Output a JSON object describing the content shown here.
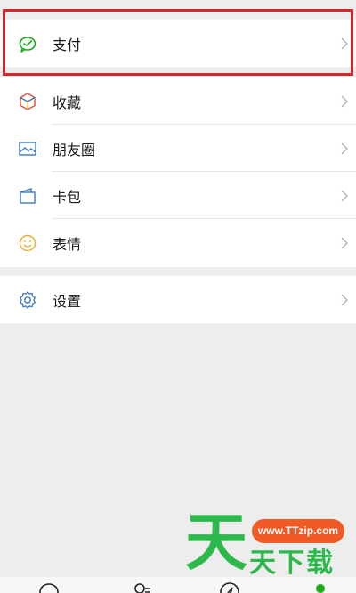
{
  "menu": {
    "pay": {
      "label": "支付",
      "icon": "wechat-pay-icon"
    },
    "items": [
      {
        "label": "收藏",
        "icon": "favorites-cube-icon"
      },
      {
        "label": "朋友圈",
        "icon": "moments-image-icon"
      },
      {
        "label": "卡包",
        "icon": "card-wallet-icon"
      },
      {
        "label": "表情",
        "icon": "emoji-smile-icon"
      }
    ],
    "settings": {
      "label": "设置",
      "icon": "gear-icon"
    }
  },
  "tabbar": {
    "icons": [
      "chat-icon",
      "contacts-icon",
      "discover-compass-icon",
      "me-icon"
    ]
  },
  "watermark": {
    "big_char": "天",
    "url": "www.TTzip.com",
    "text": "天下载"
  },
  "colors": {
    "highlight": "#d9252d",
    "pay_green": "#1aad19",
    "icon_blue": "#3b79c6",
    "emoji_yellow": "#e8b437",
    "watermark_green": "#2db84c",
    "watermark_orange": "#f15a24"
  }
}
